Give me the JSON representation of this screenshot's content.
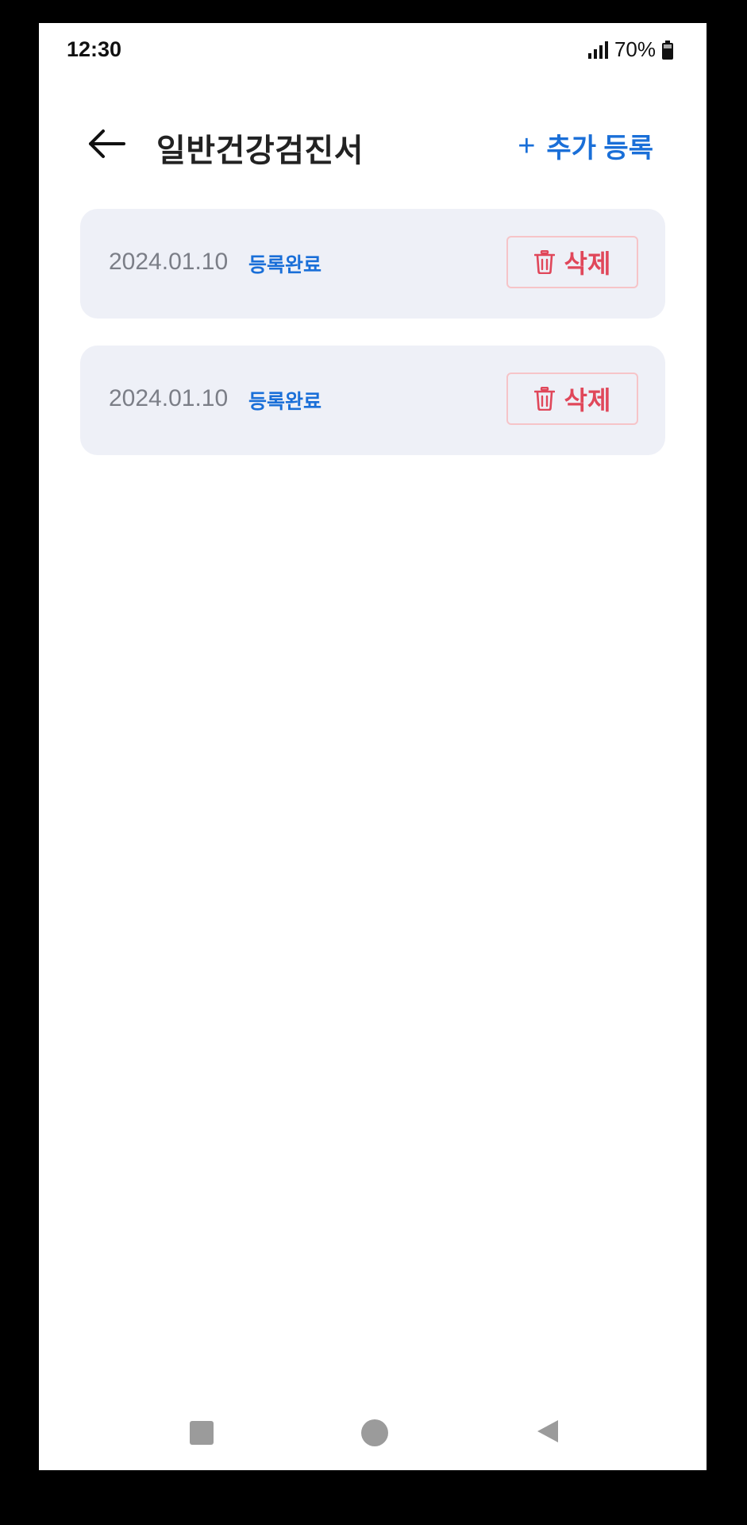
{
  "status_bar": {
    "time": "12:30",
    "battery_percent": "70%",
    "signal_icon": "cellular-signal-icon",
    "battery_icon": "battery-icon"
  },
  "header": {
    "title": "일반건강검진서",
    "back_icon": "arrow-left-icon",
    "add_label": "추가 등록",
    "add_icon_glyph": "+"
  },
  "records": [
    {
      "date": "2024.01.10",
      "status": "등록완료",
      "delete_label": "삭제"
    },
    {
      "date": "2024.01.10",
      "status": "등록완료",
      "delete_label": "삭제"
    }
  ],
  "nav_bar": {
    "recents_icon": "square-icon",
    "home_icon": "circle-icon",
    "back_icon": "triangle-back-icon"
  },
  "colors": {
    "accent": "#1a6fd8",
    "danger": "#e0475a",
    "card_background": "#eef0f7",
    "muted_text": "#7b7e87"
  }
}
